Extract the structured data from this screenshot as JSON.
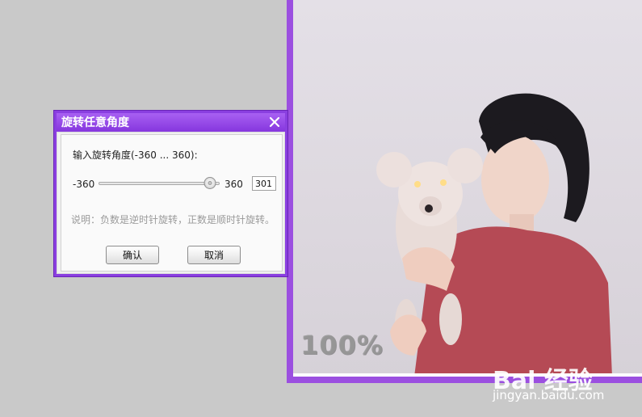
{
  "dialog": {
    "title": "旋转任意角度",
    "prompt": "输入旋转角度(-360 ... 360):",
    "slider": {
      "min_label": "-360",
      "max_label": "360",
      "value": 301,
      "min": -360,
      "max": 360
    },
    "input_value": "301",
    "note": "说明：负数是逆时针旋转，正数是顺时针旋转。",
    "ok_label": "确认",
    "cancel_label": "取消"
  },
  "viewer": {
    "zoom_label": "100%"
  },
  "watermark": {
    "brand": "Bai 经验",
    "url": "jingyan.baidu.com"
  },
  "colors": {
    "accent": "#8a3fe0",
    "frame": "#9b4fe0",
    "background": "#c9c9c9"
  }
}
